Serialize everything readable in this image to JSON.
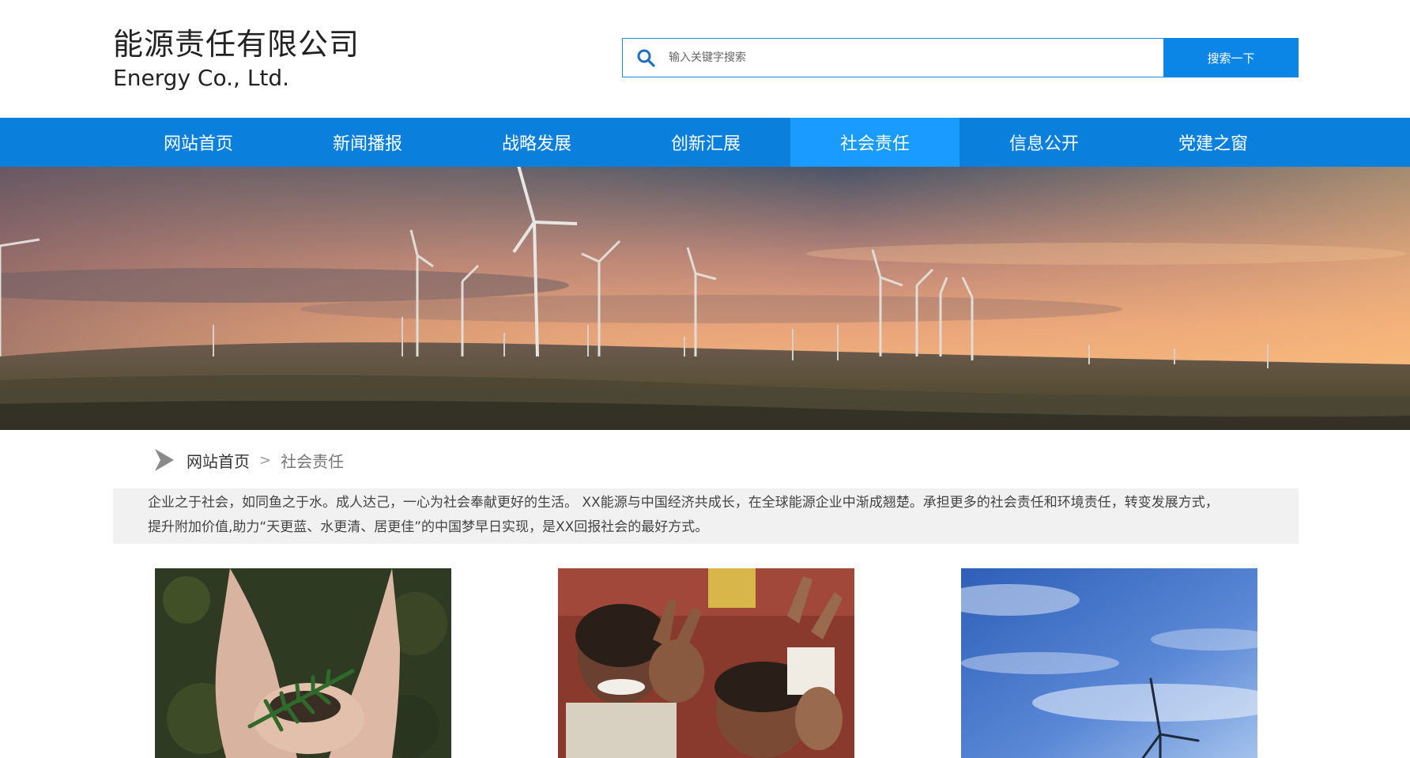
{
  "header": {
    "company_cn": "能源责任有限公司",
    "company_en": "Energy Co., Ltd."
  },
  "search": {
    "placeholder": "输入关键字搜索",
    "value": "",
    "button_label": "搜索一下",
    "icon": "search-icon"
  },
  "nav": {
    "items": [
      {
        "label": "网站首页"
      },
      {
        "label": "新闻播报"
      },
      {
        "label": "战略发展"
      },
      {
        "label": "创新汇展"
      },
      {
        "label": "社会责任"
      },
      {
        "label": "信息公开"
      },
      {
        "label": "党建之窗"
      }
    ],
    "active": "社会责任"
  },
  "breadcrumb": {
    "icon": "play-arrow-icon",
    "home": "网站首页",
    "separator": ">",
    "current": "社会责任"
  },
  "intro": {
    "line1": "企业之于社会，如同鱼之于水。成人达己，一心为社会奉献更好的生活。 XX能源与中国经济共成长，在全球能源企业中渐成翘楚。承担更多的社会责任和环境责任，转变发展方式，",
    "line2": "提升附加价值,助力“天更蓝、水更清、居更佳”的中国梦早日实现，是XX回报社会的最好方式。"
  },
  "colors": {
    "nav_bg": "#0b7fdc",
    "nav_active": "#1a9bff",
    "search_button": "#0b85e6",
    "intro_bg": "#f1f1f1"
  }
}
